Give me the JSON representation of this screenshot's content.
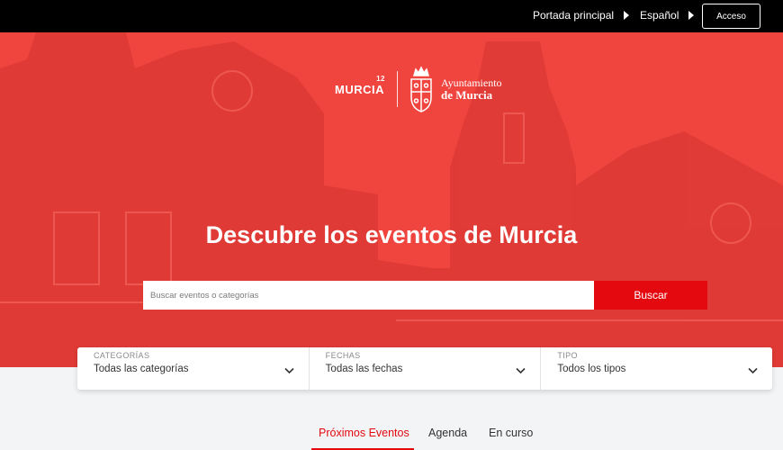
{
  "topbar": {
    "portada_label": "Portada principal",
    "idioma_label": "Español",
    "acceso_label": "Acceso"
  },
  "hero": {
    "logo_murcia": "MURCIA",
    "logo_murcia_sup": "12",
    "logo_ayto_line1": "Ayuntamiento",
    "logo_ayto_line2": "de Murcia",
    "title": "Descubre los eventos de Murcia",
    "search_placeholder": "Buscar eventos o categorías",
    "search_button": "Buscar",
    "accent_color": "#f0443f",
    "button_color": "#e3090f"
  },
  "filters": [
    {
      "label": "CATEGORÍAS",
      "value": "Todas las categorías"
    },
    {
      "label": "FECHAS",
      "value": "Todas las fechas"
    },
    {
      "label": "TIPO",
      "value": "Todos los tipos"
    }
  ],
  "tabs": [
    {
      "label": "Próximos Eventos",
      "active": true
    },
    {
      "label": "Agenda",
      "active": false
    },
    {
      "label": "En curso",
      "active": false
    }
  ],
  "icons": [
    "triangle-right-icon",
    "chevron-down-icon",
    "coat-of-arms-icon"
  ]
}
